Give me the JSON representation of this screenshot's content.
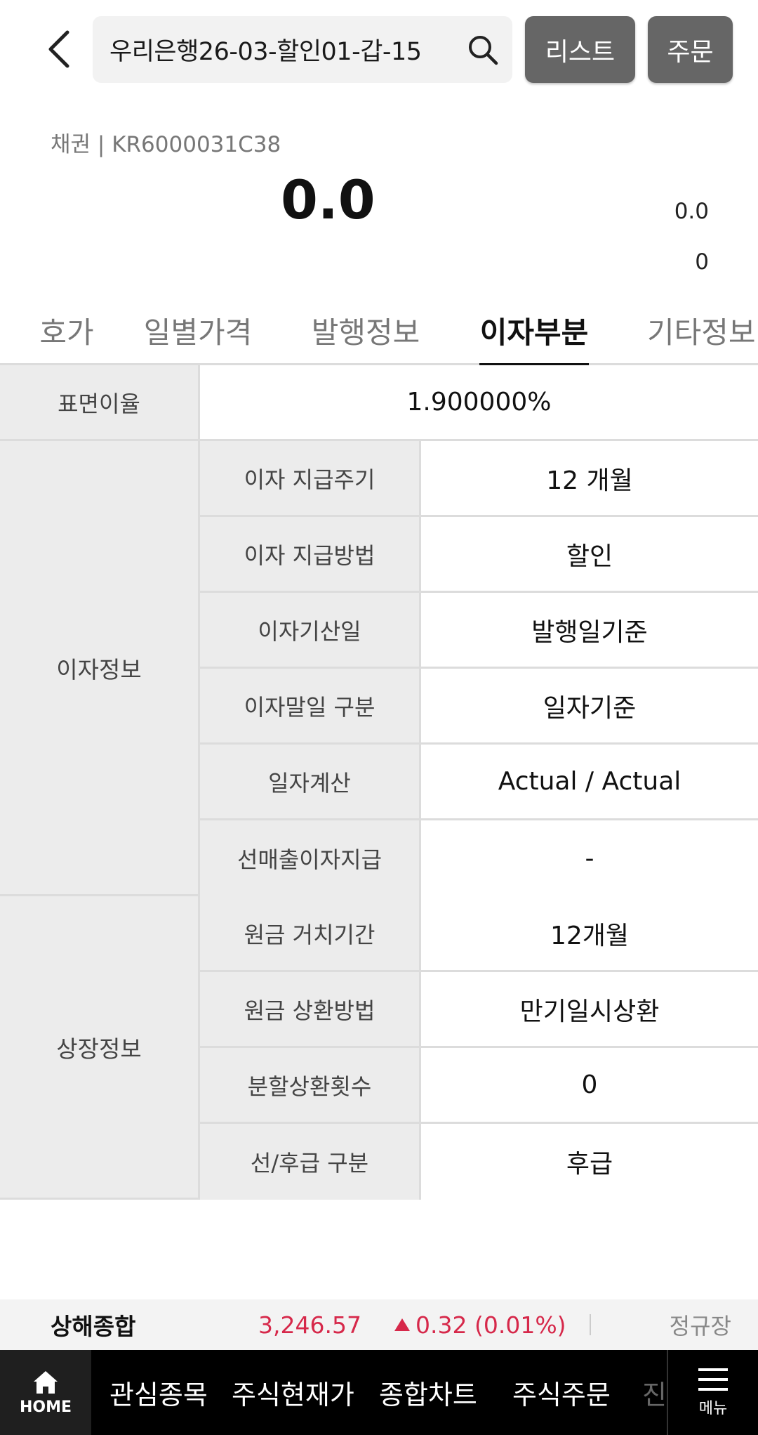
{
  "header": {
    "search_value": "우리은행26-03-할인01-갑-15",
    "list_label": "리스트",
    "order_label": "주문"
  },
  "security": {
    "meta": "채권 | KR6000031C38",
    "price": "0.0",
    "change": "0.0",
    "volume": "0"
  },
  "tabs": [
    {
      "label": "호가",
      "active": false
    },
    {
      "label": "일별가격",
      "active": false
    },
    {
      "label": "발행정보",
      "active": false
    },
    {
      "label": "이자부분",
      "active": true
    },
    {
      "label": "기타정보",
      "active": false
    }
  ],
  "table": {
    "coupon_rate": {
      "label": "표면이율",
      "value": "1.900000%"
    },
    "interest_group": {
      "label": "이자정보",
      "rows": [
        {
          "label": "이자 지급주기",
          "value": "12 개월"
        },
        {
          "label": "이자 지급방법",
          "value": "할인"
        },
        {
          "label": "이자기산일",
          "value": "발행일기준"
        },
        {
          "label": "이자말일 구분",
          "value": "일자기준"
        },
        {
          "label": "일자계산",
          "value": "Actual / Actual"
        },
        {
          "label": "선매출이자지급",
          "value": "-"
        }
      ]
    },
    "listing_group": {
      "label": "상장정보",
      "rows": [
        {
          "label": "원금 거치기간",
          "value": "12개월"
        },
        {
          "label": "원금 상환방법",
          "value": "만기일시상환"
        },
        {
          "label": "분할상환횟수",
          "value": "0"
        },
        {
          "label": "선/후급 구분",
          "value": "후급"
        }
      ]
    }
  },
  "ticker": {
    "name": "상해종합",
    "value": "3,246.57",
    "change": "0.32 (0.01%)",
    "session": "정규장",
    "up_color": "#d6284a"
  },
  "bottom_nav": {
    "home": "HOME",
    "items": [
      "관심종목",
      "주식현재가",
      "종합차트",
      "주식주문"
    ],
    "partial": "진",
    "menu": "메뉴"
  }
}
